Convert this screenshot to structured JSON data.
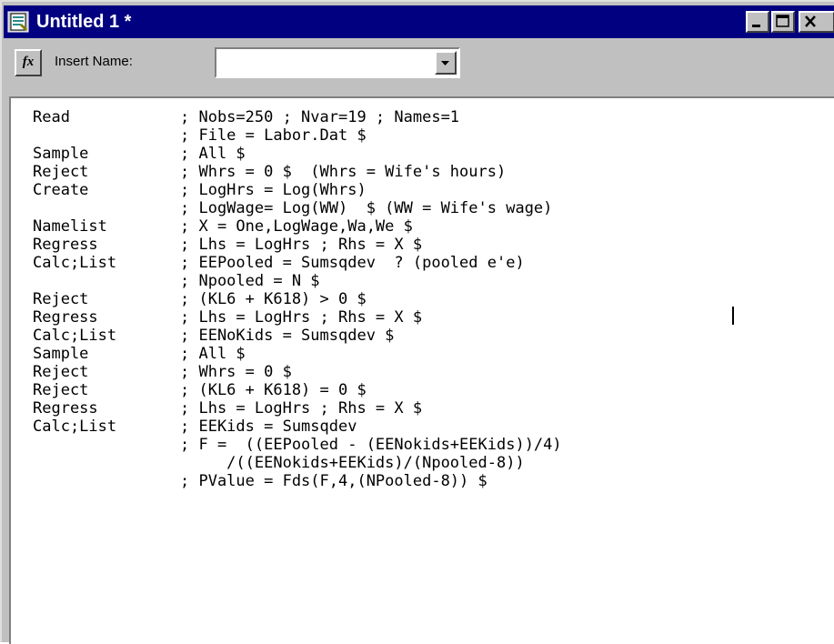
{
  "window": {
    "title": "Untitled 1 *",
    "title_bar_color": "#000080",
    "buttons": [
      {
        "name": "minimize",
        "glyph": "_"
      },
      {
        "name": "maximize",
        "glyph": "□"
      },
      {
        "name": "close",
        "glyph": "×"
      }
    ]
  },
  "toolbar": {
    "fx_label": "fx",
    "insert_name_label": "Insert Name:",
    "insert_name_value": ""
  },
  "editor": {
    "lines": [
      {
        "cmd": "Read",
        "args": "; Nobs=250 ; Nvar=19 ; Names=1"
      },
      {
        "cmd": "",
        "args": "; File = Labor.Dat $"
      },
      {
        "cmd": "Sample",
        "args": "; All $"
      },
      {
        "cmd": "Reject",
        "args": "; Whrs = 0 $  (Whrs = Wife's hours)"
      },
      {
        "cmd": "Create",
        "args": "; LogHrs = Log(Whrs)"
      },
      {
        "cmd": "",
        "args": "; LogWage= Log(WW)  $ (WW = Wife's wage)"
      },
      {
        "cmd": "Namelist",
        "args": "; X = One,LogWage,Wa,We $"
      },
      {
        "cmd": "Regress",
        "args": "; Lhs = LogHrs ; Rhs = X $"
      },
      {
        "cmd": "Calc;List",
        "args": "; EEPooled = Sumsqdev  ? (pooled e'e)"
      },
      {
        "cmd": "",
        "args": "; Npooled = N $"
      },
      {
        "cmd": "Reject",
        "args": "; (KL6 + K618) > 0 $"
      },
      {
        "cmd": "Regress",
        "args": "; Lhs = LogHrs ; Rhs = X $"
      },
      {
        "cmd": "Calc;List",
        "args": "; EENoKids = Sumsqdev $"
      },
      {
        "cmd": "Sample",
        "args": "; All $"
      },
      {
        "cmd": "Reject",
        "args": "; Whrs = 0 $"
      },
      {
        "cmd": "Reject",
        "args": "; (KL6 + K618) = 0 $"
      },
      {
        "cmd": "Regress",
        "args": "; Lhs = LogHrs ; Rhs = X $"
      },
      {
        "cmd": "Calc;List",
        "args": "; EEKids = Sumsqdev"
      },
      {
        "cmd": "",
        "args": "; F =  ((EEPooled - (EENokids+EEKids))/4)"
      },
      {
        "cmd": "",
        "args": "     /((EENokids+EEKids)/(Npooled-8))"
      },
      {
        "cmd": "",
        "args": "; PValue = Fds(F,4,(NPooled-8)) $"
      }
    ]
  }
}
